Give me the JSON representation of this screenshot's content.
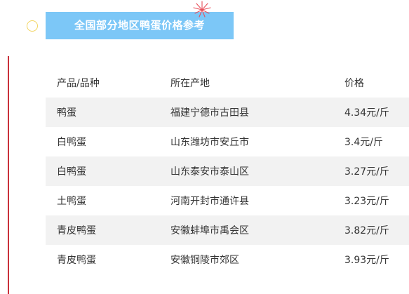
{
  "title": "全国部分地区鸭蛋价格参考",
  "table": {
    "headers": [
      "产品/品种",
      "所在产地",
      "价格"
    ],
    "rows": [
      [
        "鸭蛋",
        "福建宁德市古田县",
        "4.34元/斤"
      ],
      [
        "白鸭蛋",
        "山东潍坊市安丘市",
        "3.4元/斤"
      ],
      [
        "白鸭蛋",
        "山东泰安市泰山区",
        "3.27元/斤"
      ],
      [
        "土鸭蛋",
        "河南开封市通许县",
        "3.23元/斤"
      ],
      [
        "青皮鸭蛋",
        "安徽蚌埠市禹会区",
        "3.82元/斤"
      ],
      [
        "青皮鸭蛋",
        "安徽铜陵市郊区",
        "3.93元/斤"
      ]
    ]
  },
  "colors": {
    "banner": "#7cc7f7",
    "stripe": "#f2f2f2",
    "rule": "#c9303a",
    "circle": "#f2d560",
    "firework": "#e8505b"
  }
}
